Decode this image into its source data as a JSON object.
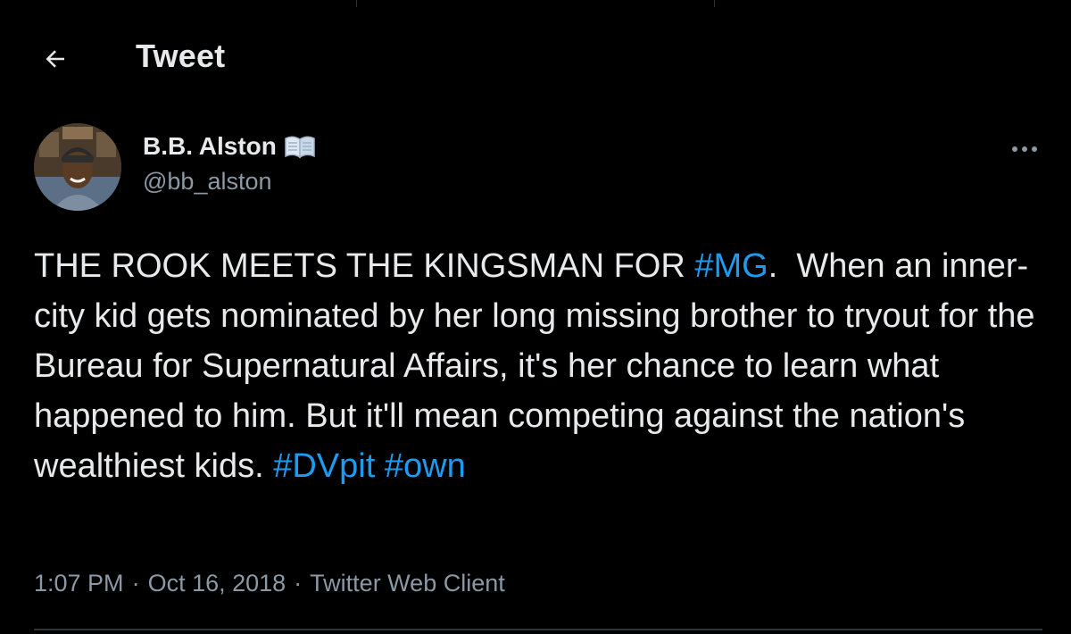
{
  "header": {
    "title": "Tweet",
    "back_icon": "arrow-left-icon"
  },
  "author": {
    "name": "B.B. Alston",
    "name_badge_icon": "open-book-icon",
    "handle": "@bb_alston",
    "avatar_icon": "avatar-photo"
  },
  "tweet": {
    "text_part1": "THE ROOK MEETS THE KINGSMAN FOR ",
    "hashtag_mg": "#MG",
    "text_part2": ".  When an inner-city kid gets nominated by her long missing brother to tryout for the Bureau for Supernatural Affairs, it's her chance to learn what happened to him. But it'll mean competing against the nation's wealthiest kids. ",
    "hashtag_dvpit": "#DVpit",
    "hashtag_own": "#own"
  },
  "meta": {
    "time": "1:07 PM",
    "separator": "·",
    "date": "Oct 16, 2018",
    "client": "Twitter Web Client"
  },
  "colors": {
    "background": "#000000",
    "text": "#e7e9ea",
    "muted": "#8b98a5",
    "accent": "#1d9bf0",
    "divider": "#2f3336"
  }
}
